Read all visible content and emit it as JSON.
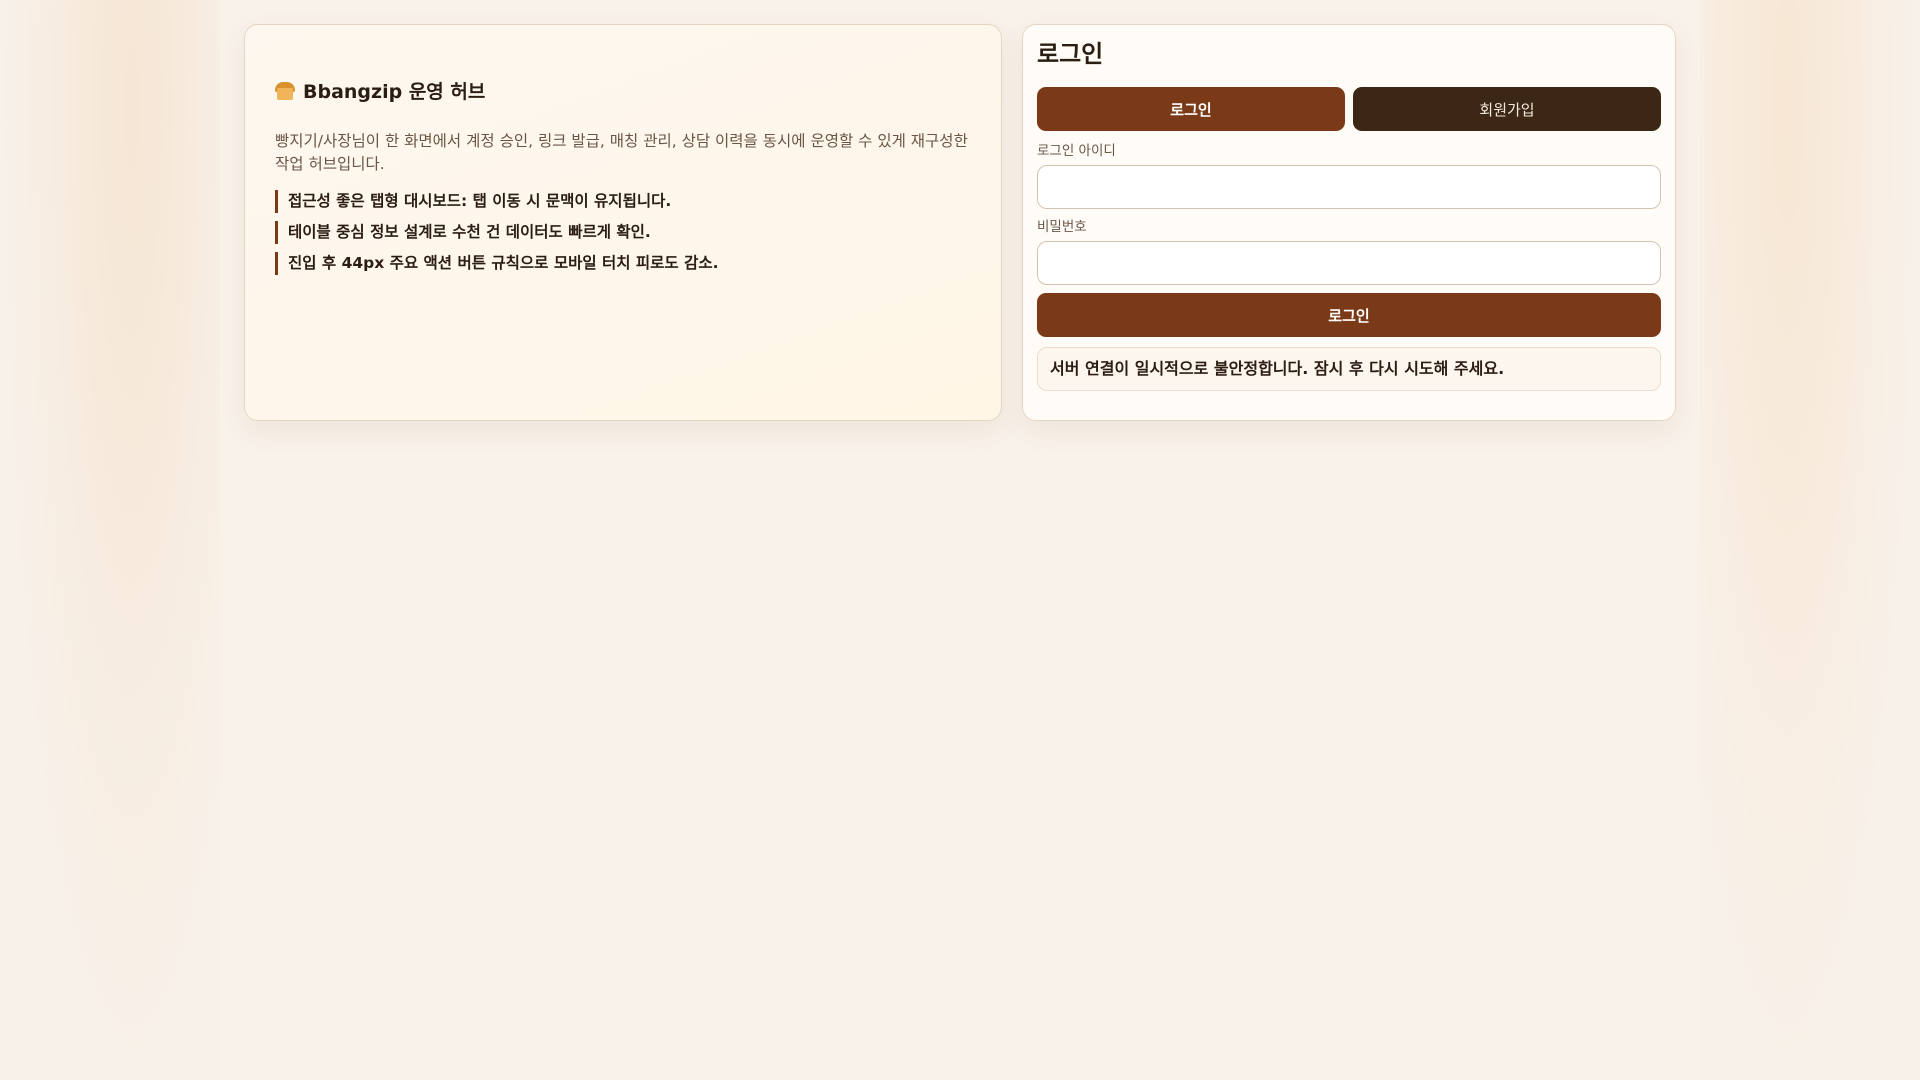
{
  "hero": {
    "icon": "bread-icon",
    "title": "Bbangzip 운영 허브",
    "description": "빵지기/사장님이 한 화면에서 계정 승인, 링크 발급, 매칭 관리, 상담 이력을 동시에 운영할 수 있게 재구성한 작업 허브입니다.",
    "features": [
      "접근성 좋은 탭형 대시보드: 탭 이동 시 문맥이 유지됩니다.",
      "테이블 중심 정보 설계로 수천 건 데이터도 빠르게 확인.",
      "진입 후 44px 주요 액션 버튼 규칙으로 모바일 터치 피로도 감소."
    ]
  },
  "login": {
    "title": "로그인",
    "tabs": {
      "login_label": "로그인",
      "signup_label": "회원가입"
    },
    "id_label": "로그인 아이디",
    "id_value": "",
    "password_label": "비밀번호",
    "password_value": "",
    "submit_label": "로그인",
    "status_message": "서버 연결이 일시적으로 불안정합니다. 잠시 후 다시 시도해 주세요."
  },
  "colors": {
    "accent": "#7b3a17",
    "dark": "#3b2714",
    "background": "#f9f2ea"
  }
}
